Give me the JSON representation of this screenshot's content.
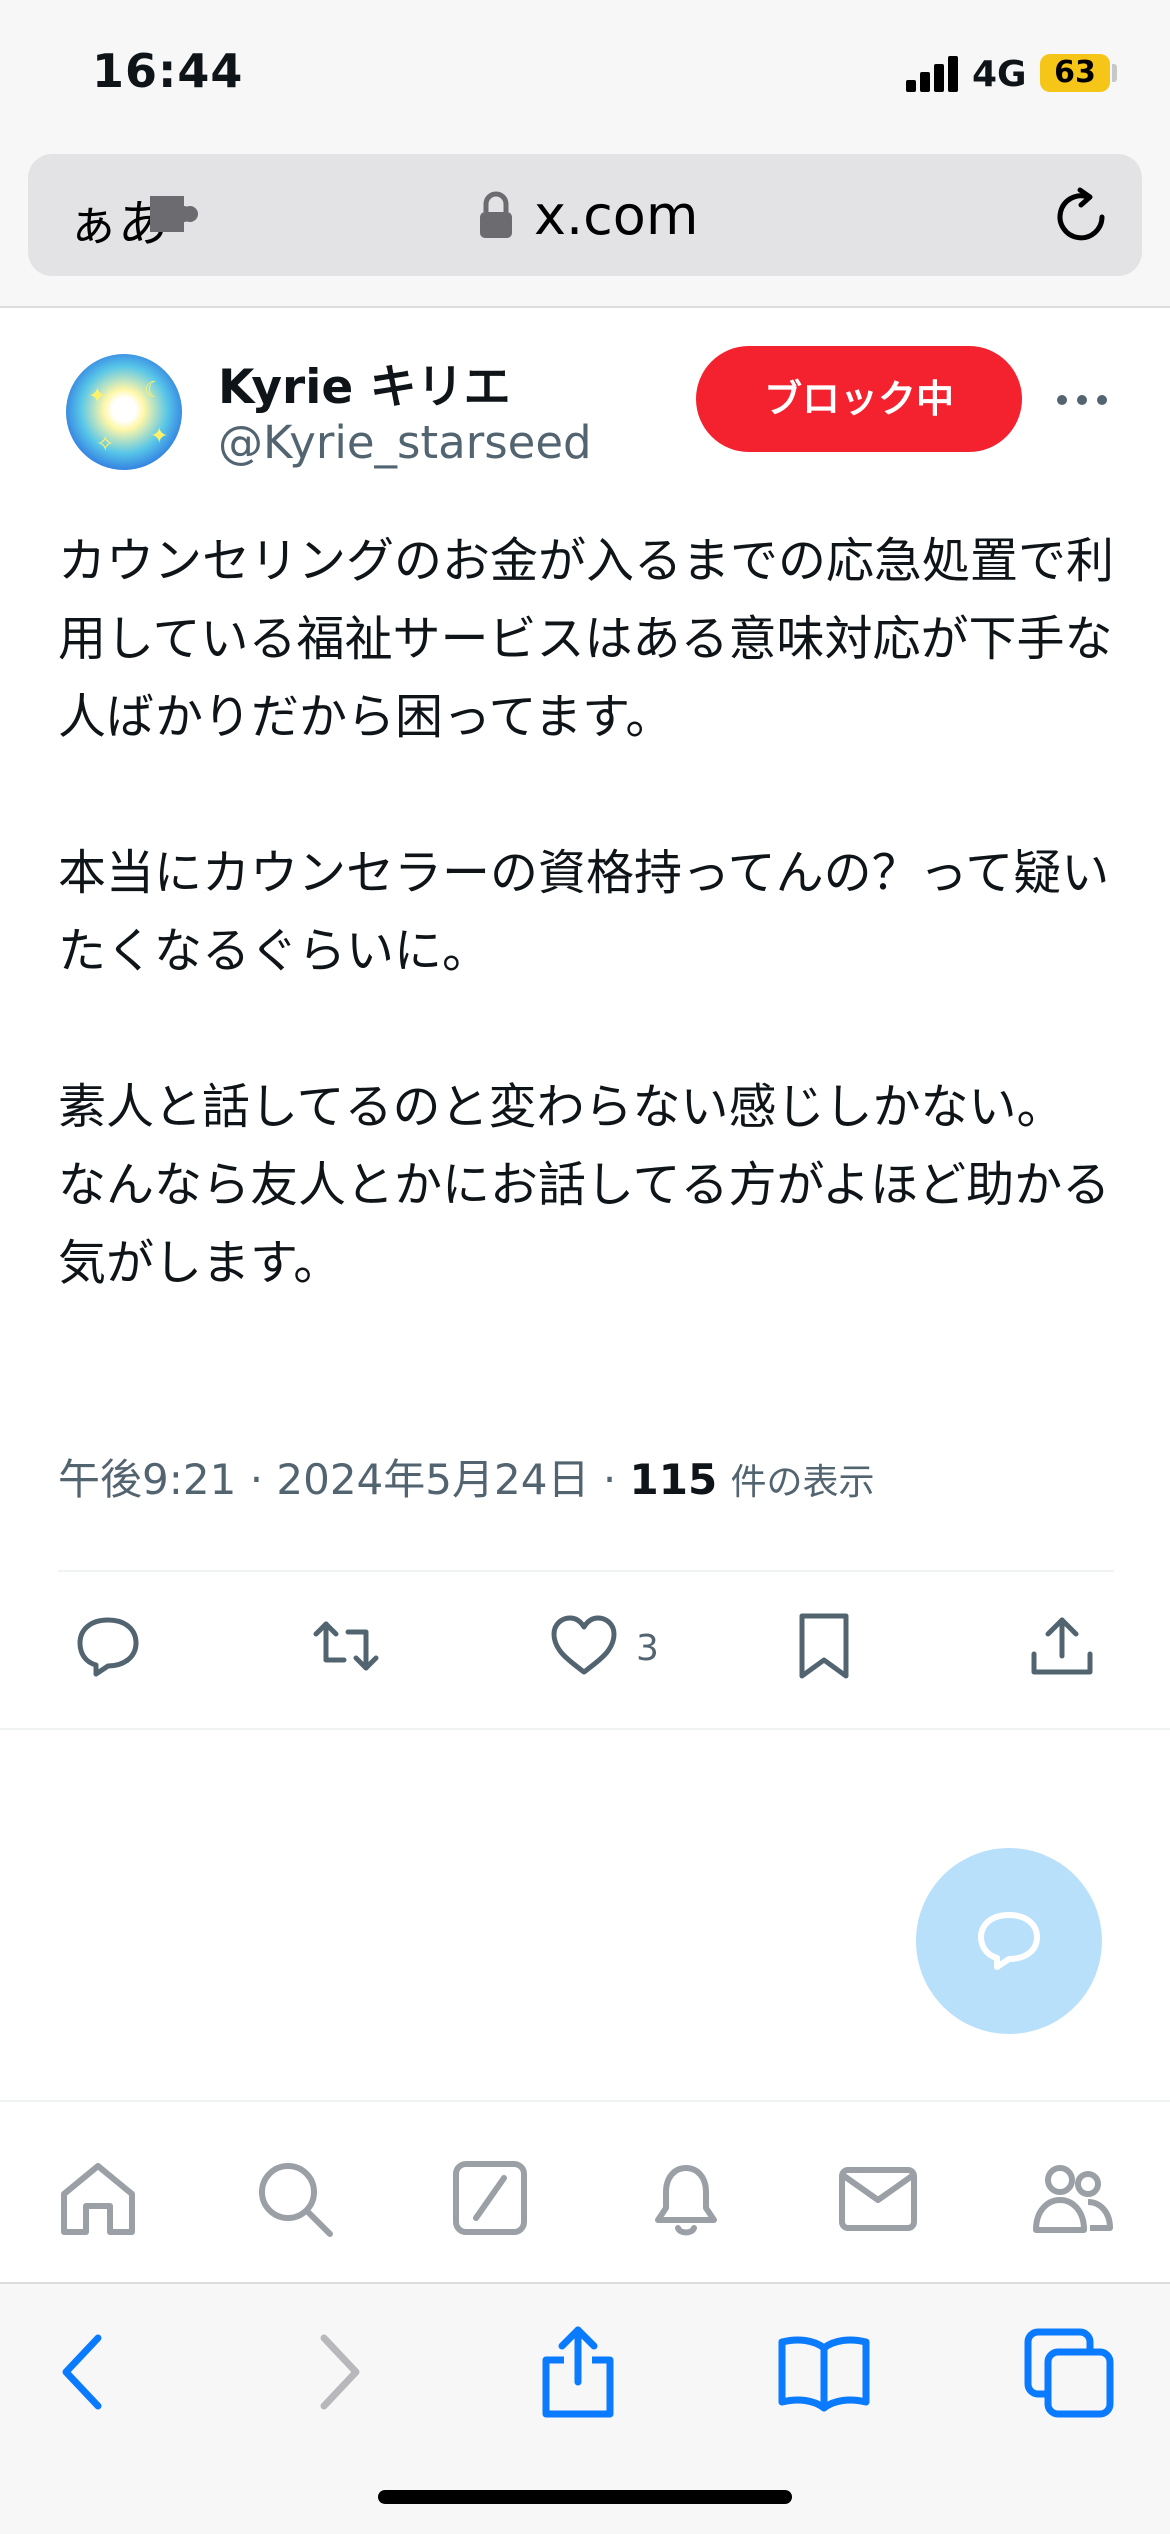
{
  "status_bar": {
    "time": "16:44",
    "network": "4G",
    "battery": "63",
    "battery_color": "#f5c518"
  },
  "browser": {
    "reader_label": "ぁあ",
    "url": "x.com",
    "icons": [
      "extension-icon",
      "lock-icon",
      "reload-icon"
    ]
  },
  "tweet": {
    "display_name": "Kyrie キリエ",
    "handle": "@Kyrie_starseed",
    "block_button_label": "ブロック中",
    "block_button_color": "#f4212e",
    "body": {
      "p1": "カウンセリングのお金が入るまでの応急処置で利用している福祉サービスはある意味対応が下手な人ばかりだから困ってます。",
      "p2": "本当にカウンセラーの資格持ってんの？って疑いたくなるぐらいに。",
      "p3_line1": "素人と話してるのと変わらない感じしかない。",
      "p3_line2": "なんなら友人とかにお話してる方がよほど助かる気がします。"
    },
    "time": "午後9:21",
    "date": "2024年5月24日",
    "views_count": "115",
    "views_label": "件の表示",
    "like_count": "3"
  },
  "actions": [
    "reply-icon",
    "retweet-icon",
    "like-icon",
    "bookmark-icon",
    "share-icon"
  ],
  "fab": {
    "icon": "compose-reply-icon",
    "color": "#b9e0fb"
  },
  "x_nav": [
    "home-icon",
    "search-icon",
    "grok-icon",
    "notifications-icon",
    "messages-icon",
    "communities-icon"
  ],
  "safari_toolbar": [
    "back-icon",
    "forward-icon",
    "share-icon",
    "bookmarks-icon",
    "tabs-icon"
  ]
}
